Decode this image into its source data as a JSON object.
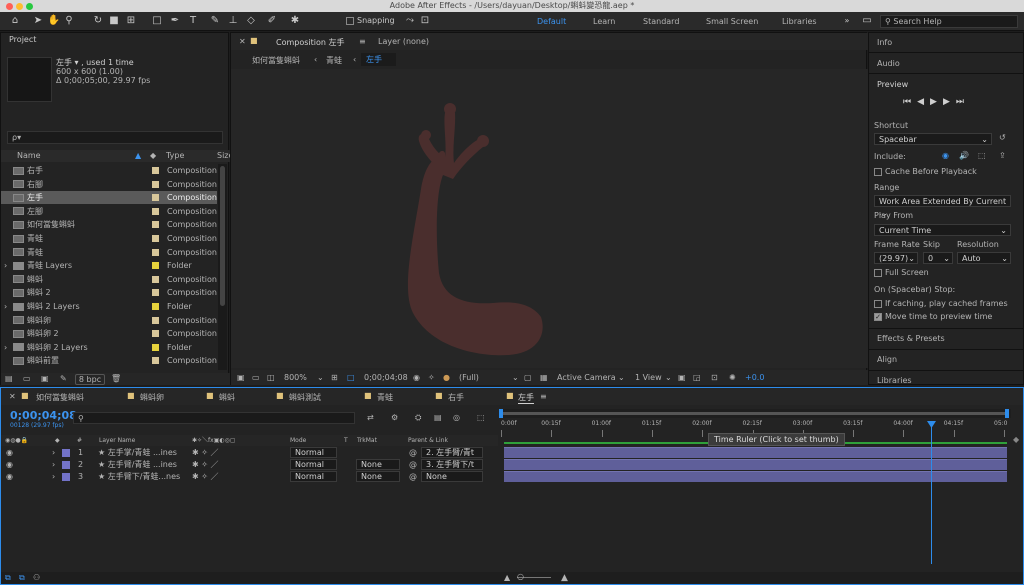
{
  "window": {
    "title": "Adobe After Effects - /Users/dayuan/Desktop/蝌蚪變恐龍.aep *"
  },
  "toolbar": {
    "snapping": "Snapping",
    "workspaces": [
      "Default",
      "Learn",
      "Standard",
      "Small Screen",
      "Libraries"
    ],
    "search": "Search Help"
  },
  "project": {
    "title": "Project",
    "item_name": "左手 ▾ , used 1 time",
    "item_size": "600 x 600 (1.00)",
    "item_dur": "Δ 0;00;05;00, 29.97 fps",
    "search_placeholder": "ρ▾",
    "col_name": "Name",
    "col_type": "Type",
    "col_size": "Size",
    "bpc": "8 bpc",
    "items": [
      {
        "name": "右手",
        "type": "Composition",
        "kind": "comp",
        "color": "#d8c79a"
      },
      {
        "name": "右腳",
        "type": "Composition",
        "kind": "comp",
        "color": "#d8c79a"
      },
      {
        "name": "左手",
        "type": "Composition",
        "kind": "comp",
        "color": "#d8c79a"
      },
      {
        "name": "左腳",
        "type": "Composition",
        "kind": "comp",
        "color": "#d8c79a"
      },
      {
        "name": "如何當隻蝌蚪",
        "type": "Composition",
        "kind": "comp",
        "color": "#d8c79a"
      },
      {
        "name": "青蛙",
        "type": "Composition",
        "kind": "comp",
        "color": "#d8c79a"
      },
      {
        "name": "青蛙",
        "type": "Composition",
        "kind": "comp",
        "color": "#d8c79a"
      },
      {
        "name": "青蛙 Layers",
        "type": "Folder",
        "kind": "folder",
        "color": "#e6d23c"
      },
      {
        "name": "蝌蚪",
        "type": "Composition",
        "kind": "comp",
        "color": "#d8c79a"
      },
      {
        "name": "蝌蚪 2",
        "type": "Composition",
        "kind": "comp",
        "color": "#d8c79a"
      },
      {
        "name": "蝌蚪 2 Layers",
        "type": "Folder",
        "kind": "folder",
        "color": "#e6d23c"
      },
      {
        "name": "蝌蚪卵",
        "type": "Composition",
        "kind": "comp",
        "color": "#d8c79a"
      },
      {
        "name": "蝌蚪卵 2",
        "type": "Composition",
        "kind": "comp",
        "color": "#d8c79a"
      },
      {
        "name": "蝌蚪卵 2 Layers",
        "type": "Folder",
        "kind": "folder",
        "color": "#e6d23c"
      },
      {
        "name": "蝌蚪前置",
        "type": "Composition",
        "kind": "comp",
        "color": "#d8c79a"
      }
    ]
  },
  "viewer": {
    "tab": "Composition 左手",
    "layer_tab": "Layer (none)",
    "crumbs": [
      "如何當隻蝌蚪",
      "青蛙",
      "左手"
    ],
    "zoom": "800%",
    "time": "0;00;04;08",
    "quality": "(Full)",
    "camera": "Active Camera",
    "views": "1 View",
    "exposure": "+0.0"
  },
  "right": {
    "info": "Info",
    "audio": "Audio",
    "preview": "Preview",
    "shortcut_label": "Shortcut",
    "shortcut": "Spacebar",
    "include": "Include:",
    "cache": "Cache Before Playback",
    "range_label": "Range",
    "range": "Work Area Extended By Current ...",
    "playfrom_label": "Play From",
    "playfrom": "Current Time",
    "fr_label": "Frame Rate",
    "skip_label": "Skip",
    "res_label": "Resolution",
    "fr": "(29.97)",
    "skip": "0",
    "res": "Auto",
    "fullscreen": "Full Screen",
    "stop_label": "On (Spacebar) Stop:",
    "stop1": "If caching, play cached frames",
    "stop2": "Move time to preview time",
    "effects": "Effects & Presets",
    "align": "Align",
    "libraries": "Libraries"
  },
  "timeline": {
    "tabs": [
      "如何當隻蝌蚪",
      "蝌蚪卵",
      "蝌蚪",
      "蝌蚪測試",
      "青蛙",
      "右手",
      "左手"
    ],
    "time": "0;00;04;08",
    "fps": "00128 (29.97 fps)",
    "cols": {
      "num": "#",
      "name": "Layer Name",
      "mode": "Mode",
      "t": "T",
      "trkmat": "TrkMat",
      "parent": "Parent & Link"
    },
    "ruler": [
      "0:00f",
      "00:15f",
      "01:00f",
      "01:15f",
      "02:00f",
      "02:15f",
      "03:00f",
      "03:15f",
      "04:00f",
      "04:15f",
      "05:0"
    ],
    "tooltip": "Time Ruler (Click to set thumb)",
    "layers": [
      {
        "num": "1",
        "name": "★ 左手掌/青蛙 ...ines",
        "mode": "Normal",
        "trkmat": "",
        "parent": "2. 左手臂/青t"
      },
      {
        "num": "2",
        "name": "★ 左手臂/青蛙 ...ines",
        "mode": "Normal",
        "trkmat": "None",
        "parent": "3. 左手臂下/t"
      },
      {
        "num": "3",
        "name": "★ 左手臂下/青蛙...nes",
        "mode": "Normal",
        "trkmat": "None",
        "parent": "None"
      }
    ]
  },
  "colors": {
    "accent": "#2d8ceb",
    "layer": "#5f5f9a",
    "bg": "#1d1d1d"
  }
}
